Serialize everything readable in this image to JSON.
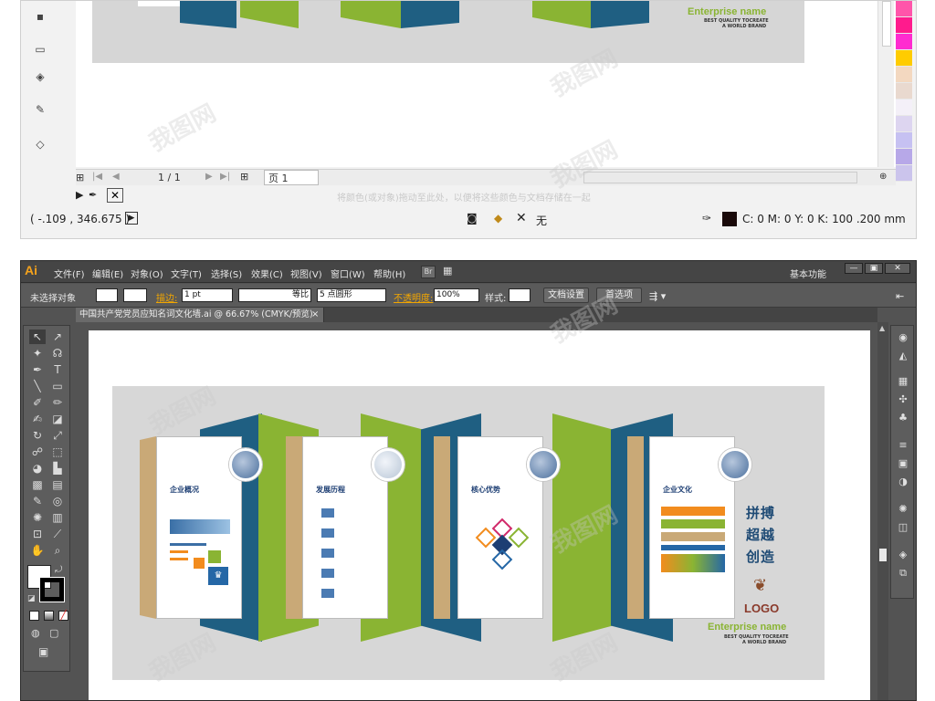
{
  "top_window": {
    "enterprise_name": "Enterprise name",
    "slogan_line1": "BEST QUALITY TOCREATE",
    "slogan_line2": "A WORLD BRAND",
    "page_counter": "1 / 1",
    "page_tab": "页 1",
    "status_hint": "将颜色(或对象)拖动至此处，以便将这些颜色与文档存储在一起",
    "cursor_coords": "( -.109 , 346.675 )",
    "fill_none_label": "无",
    "outline_info": "C: 0 M: 0 Y: 0 K: 100  .200 mm",
    "palette_colors": [
      "#ff55aa",
      "#ff1b8d",
      "#ff2bd0",
      "#ffcc00",
      "#f3d8c0",
      "#e9d9cf",
      "#f4f0f8",
      "#ddd5f0",
      "#c6c1f2",
      "#b7a8e8",
      "#cbc4ec"
    ]
  },
  "ai_window": {
    "logo": "Ai",
    "menu": [
      "文件(F)",
      "编辑(E)",
      "对象(O)",
      "文字(T)",
      "选择(S)",
      "效果(C)",
      "视图(V)",
      "窗口(W)",
      "帮助(H)"
    ],
    "bridge_label": "Br",
    "workspace": "基本功能",
    "control": {
      "no_selection": "未选择对象",
      "stroke_label": "描边:",
      "stroke_value": "1 pt",
      "stroke_profile": "等比",
      "brush": "5 点圆形",
      "opacity_label": "不透明度:",
      "opacity_value": "100%",
      "style_label": "样式:",
      "doc_setup": "文档设置",
      "preferences": "首选项"
    },
    "document_tab": "中国共产党党员应知名词文化墙.ai @ 66.67% (CMYK/预览)",
    "document_tab_close": "×"
  },
  "artwork": {
    "cards": [
      {
        "title": "企业概况"
      },
      {
        "title": "发展历程"
      },
      {
        "title": "核心优势"
      },
      {
        "title": "企业文化"
      }
    ],
    "slogan": [
      "拼搏",
      "超越",
      "创造"
    ],
    "logo_text": "LOGO",
    "enterprise_name": "Enterprise name",
    "tagline1": "BEST QUALITY TOCREATE",
    "tagline2": "A WORLD BRAND",
    "colors": {
      "blue": "#1f5f82",
      "green": "#8ab433",
      "tan": "#c9a977",
      "bg": "#d7d7d7"
    }
  }
}
